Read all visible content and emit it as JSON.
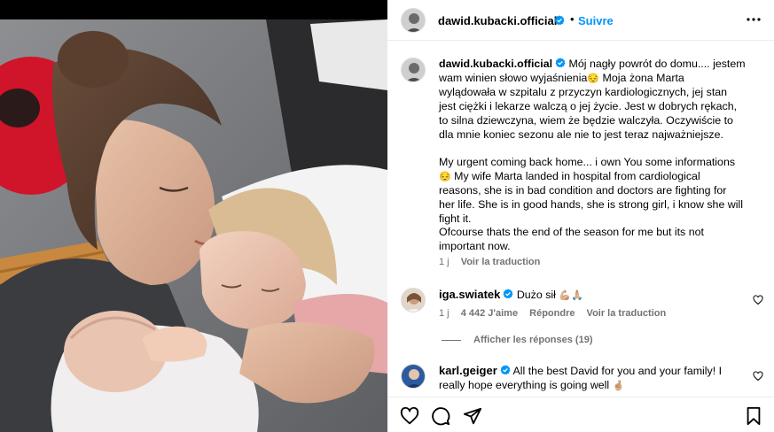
{
  "post": {
    "username": "dawid.kubacki.official",
    "follow_label": "Suivre",
    "caption_lines": [
      "Mój nagły powrót do domu.... jestem",
      "wam winien słowo wyjaśnienia",
      "Moja żona Marta",
      "wylądowała w szpitalu z przyczyn kardiologicznych, jej stan",
      "jest ciężki i lekarze walczą o jej życie. Jest w dobrych rękach,",
      "to silna dziewczyna, wiem że będzie walczyła. Oczywiście to",
      "dla mnie koniec sezonu ale nie to jest teraz najważniejsze.",
      "My urgent coming back home... i own You some informations",
      "My wife Marta landed in hospital from cardiological",
      "reasons, she is in bad condition and doctors are fighting for",
      "her life. She is in good hands, she is strong girl, i know she will",
      "fight it.",
      "Ofcourse thats the end of the season for me but its not",
      "important now."
    ],
    "time": "1 j",
    "translate_label": "Voir la traduction"
  },
  "comments": [
    {
      "username": "iga.swiatek",
      "text": "Dużo sił",
      "emojis": "💪🏼🙏🏼",
      "time": "1 j",
      "likes": "4 442 J'aime",
      "reply_label": "Répondre",
      "translate_label": "Voir la traduction"
    },
    {
      "username": "karl.geiger",
      "text_line1": "All the best David for you and your family! I",
      "text_line2": "really hope everything is going well"
    }
  ],
  "replies_label": "Afficher les réponses (19)",
  "icons": {
    "more": "more-options-icon",
    "verified": "verified-badge-icon",
    "like": "heart-icon",
    "comment": "comment-icon",
    "share": "share-icon",
    "save": "bookmark-icon"
  },
  "colors": {
    "accent": "#0095f6",
    "verified": "#0095f6",
    "secondary_text": "#737373"
  }
}
